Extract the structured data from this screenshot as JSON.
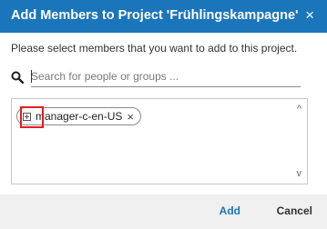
{
  "dialog": {
    "title": "Add Members to Project 'Frühlingskampagne'",
    "close_symbol": "×",
    "instruction": "Please select members that you want to add to this project."
  },
  "search": {
    "placeholder": "Search for people or groups ...",
    "value": "",
    "icon": "search-icon"
  },
  "selected_members": [
    {
      "label": "manager-c-en-US",
      "icon": "expand-plus-icon",
      "remove_symbol": "×"
    }
  ],
  "scrollbar": {
    "up_symbol": "^",
    "down_symbol": "v"
  },
  "footer": {
    "add_label": "Add",
    "cancel_label": "Cancel"
  },
  "colors": {
    "title_bar": "#1b75bb",
    "add_button": "#1b75bb",
    "highlight": "#e02020",
    "footer_bg": "#f0f0f0"
  }
}
